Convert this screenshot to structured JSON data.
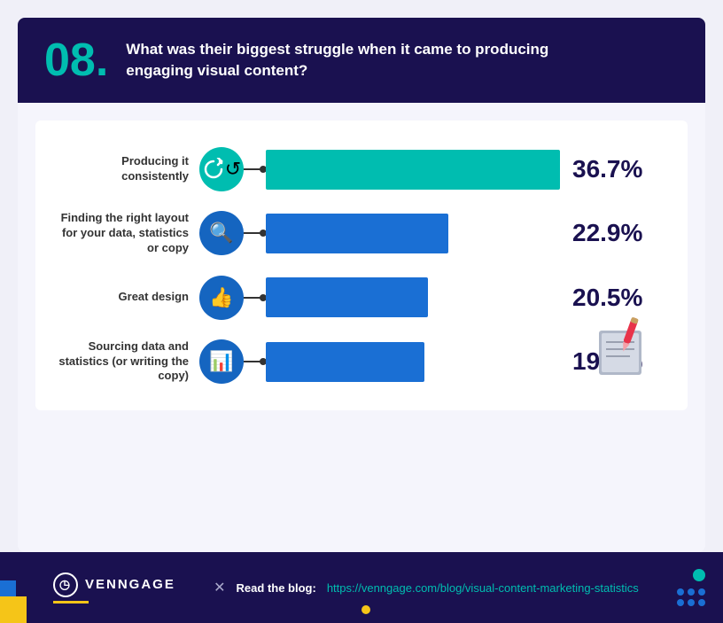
{
  "header": {
    "number": "08.",
    "question": "What was their biggest struggle when it came to producing engaging visual content?"
  },
  "bars": [
    {
      "label": "Producing it consistently",
      "icon": "🔄",
      "icon_class": "icon-teal",
      "bar_class": "bar-fill-teal",
      "percentage_value": 36.7,
      "percentage_label": "36.7%",
      "bar_width_pct": 100
    },
    {
      "label": "Finding the right layout for your data, statistics or copy",
      "icon": "🔍",
      "icon_class": "icon-blue",
      "bar_class": "bar-fill-blue",
      "percentage_value": 22.9,
      "percentage_label": "22.9%",
      "bar_width_pct": 62
    },
    {
      "label": "Great design",
      "icon": "👍",
      "icon_class": "icon-blue",
      "bar_class": "bar-fill-blue",
      "percentage_value": 20.5,
      "percentage_label": "20.5%",
      "bar_width_pct": 55
    },
    {
      "label": "Sourcing data and statistics (or writing the copy)",
      "icon": "📊",
      "icon_class": "icon-blue",
      "bar_class": "bar-fill-blue",
      "percentage_value": 19.9,
      "percentage_label": "19.9%",
      "bar_width_pct": 54
    }
  ],
  "footer": {
    "logo_name": "VENNGAGE",
    "blog_label": "Read the blog:",
    "blog_url": "https://venngage.com/blog/visual-content-marketing-statistics",
    "x_symbol": "✕"
  }
}
